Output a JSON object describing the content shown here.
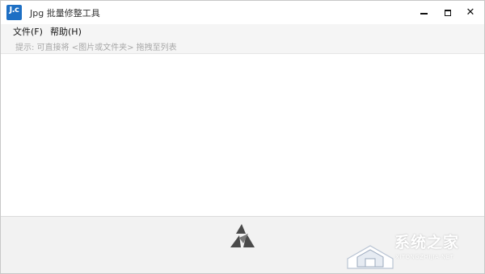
{
  "window": {
    "title": "Jpg 批量修整工具",
    "app_icon_text": "J.c"
  },
  "controls": {
    "minimize_icon": "minimize-icon",
    "maximize_icon": "maximize-icon",
    "close_glyph": "✕"
  },
  "menu": {
    "file": "文件(F)",
    "help": "帮助(H)"
  },
  "hint": "提示: 可直接将 <图片或文件夹> 拖拽至列表",
  "footer": {
    "logo_icon": "triangle-logo-icon"
  },
  "watermark": {
    "text": "系统之家",
    "sub": "XITONGZHIJIA.NET"
  },
  "colors": {
    "accent": "#1d6fc4",
    "logo": "#4a4a4a",
    "background": "#f0f0f0",
    "list_background": "#ffffff"
  }
}
